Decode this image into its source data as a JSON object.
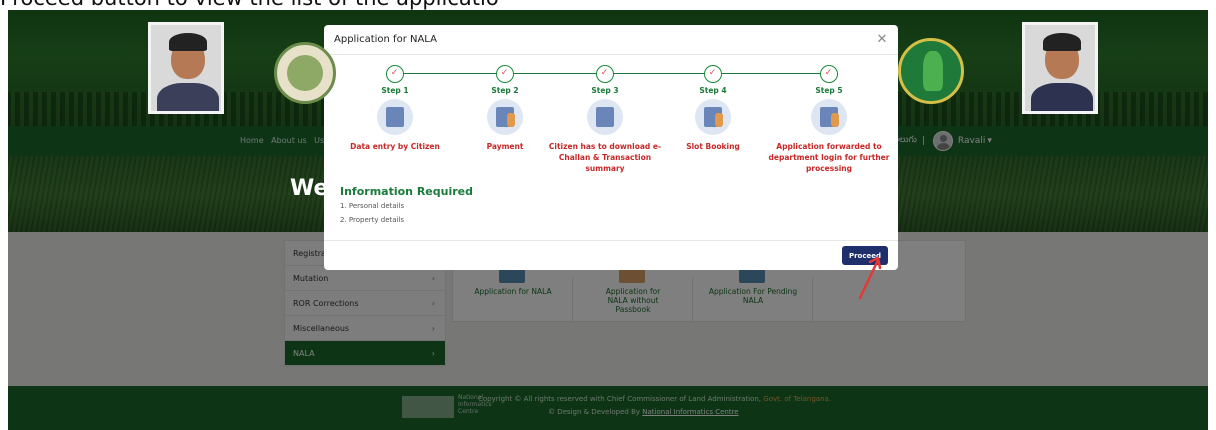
{
  "instruction": "Proceed button to view the list of the applicatio",
  "navbar": {
    "links": [
      "Home",
      "About us",
      "Use"
    ],
    "telugu": "తెలుగు",
    "separator": "|",
    "user": "Ravali"
  },
  "hero": {
    "welcome": "Wel"
  },
  "sidebar": {
    "items": [
      {
        "label": "Registra"
      },
      {
        "label": "Mutation"
      },
      {
        "label": "ROR Corrections"
      },
      {
        "label": "Miscellaneous"
      },
      {
        "label": "NALA"
      }
    ],
    "active_index": 4
  },
  "cards": [
    {
      "label": "Application for NALA"
    },
    {
      "label": "Application for NALA without Passbook"
    },
    {
      "label": "Application For Pending NALA"
    }
  ],
  "footer": {
    "nic": [
      "National",
      "Informatics",
      "Centre"
    ],
    "copyright": "Copyright © All rights reserved with Chief Commissioner of Land Administration,",
    "gov": "Govt. of Telangana.",
    "design_prefix": "© Design & Developed By",
    "nic_link": "National Informatics Centre"
  },
  "modal": {
    "title": "Application for NALA",
    "close_icon": "close-icon",
    "steps": [
      {
        "title": "Step 1",
        "desc": "Data entry by Citizen",
        "icon": "data-entry-icon"
      },
      {
        "title": "Step 2",
        "desc": "Payment",
        "icon": "payment-icon"
      },
      {
        "title": "Step 3",
        "desc": "Citizen has to download e-Challan & Transaction summary",
        "icon": "challan-icon"
      },
      {
        "title": "Step 4",
        "desc": "Slot Booking",
        "icon": "slot-booking-icon"
      },
      {
        "title": "Step 5",
        "desc": "Application forwarded to department login for further processing",
        "icon": "forward-icon"
      }
    ],
    "info_title": "Information Required",
    "info_items": [
      "1. Personal details",
      "2. Property details"
    ],
    "proceed_label": "Proceed"
  },
  "colors": {
    "green": "#1a6b2a",
    "step_green": "#1a7a3a",
    "red_text": "#c62828",
    "proceed_bg": "#1f2f6b",
    "arrow_red": "#e53935"
  }
}
